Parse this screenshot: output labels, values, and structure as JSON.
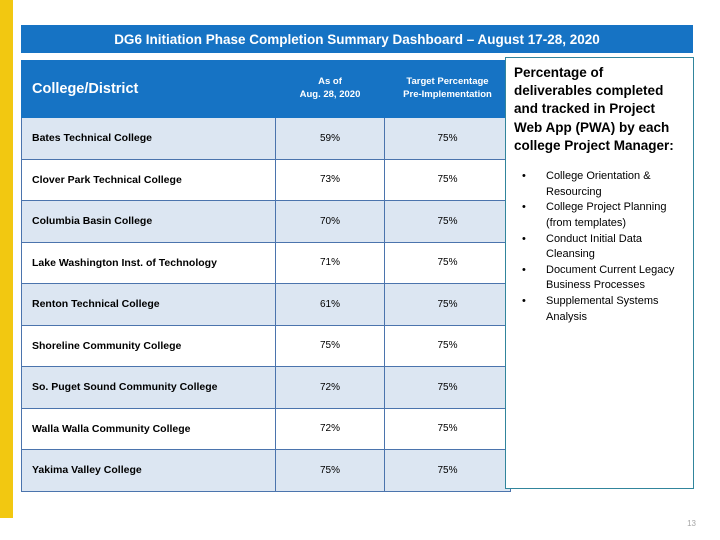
{
  "slide": {
    "title": "DG6 Initiation Phase Completion Summary Dashboard – August 17-28, 2020",
    "page_number": "13",
    "accent_color": "#f2c811",
    "header_color": "#1673c4",
    "row_shade_color": "#dce6f2",
    "panel_border_color": "#31859c"
  },
  "table": {
    "headers": {
      "college": "College/District",
      "asof_line1": "As of",
      "asof_line2": "Aug. 28, 2020",
      "target_line1": "Target Percentage",
      "target_line2": "Pre-Implementation"
    },
    "rows": [
      {
        "college": "Bates Technical College",
        "as_of": "59%",
        "target": "75%"
      },
      {
        "college": "Clover Park Technical College",
        "as_of": "73%",
        "target": "75%"
      },
      {
        "college": "Columbia Basin College",
        "as_of": "70%",
        "target": "75%"
      },
      {
        "college": "Lake Washington Inst. of Technology",
        "as_of": "71%",
        "target": "75%"
      },
      {
        "college": "Renton Technical College",
        "as_of": "61%",
        "target": "75%"
      },
      {
        "college": "Shoreline Community College",
        "as_of": "75%",
        "target": "75%"
      },
      {
        "college": "So. Puget Sound Community College",
        "as_of": "72%",
        "target": "75%"
      },
      {
        "college": "Walla Walla Community College",
        "as_of": "72%",
        "target": "75%"
      },
      {
        "college": "Yakima Valley College",
        "as_of": "75%",
        "target": "75%"
      }
    ]
  },
  "callout": {
    "heading": "Percentage of deliverables completed and tracked in Project Web App (PWA) by each college Project Manager:",
    "bullet_glyph": "•",
    "items": [
      "College Orientation & Resourcing",
      "College Project Planning (from templates)",
      "Conduct Initial Data Cleansing",
      "Document Current Legacy Business Processes",
      "Supplemental Systems Analysis"
    ]
  }
}
